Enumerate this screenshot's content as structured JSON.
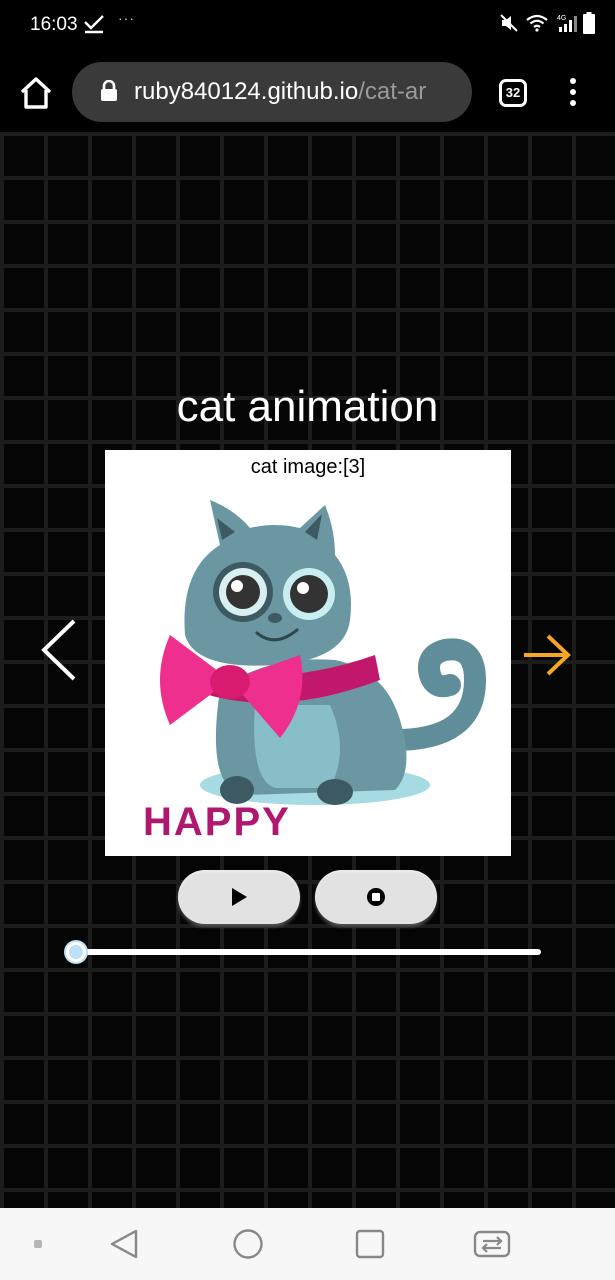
{
  "status_bar": {
    "time": "16:03",
    "notification_dots": "···",
    "network_label": "4G"
  },
  "browser": {
    "url_domain": "ruby840124.github.io",
    "url_path": "/cat-ar",
    "tab_count": "32"
  },
  "page": {
    "title": "cat animation",
    "image_caption": "cat image:[3]",
    "image_text": "HAPPY",
    "slider": {
      "value": 0,
      "min": 0,
      "max": 1
    }
  },
  "colors": {
    "next_arrow": "#f5a623",
    "background": "#000000",
    "card": "#ffffff",
    "control_button": "#e2e2e2"
  },
  "icons": {
    "home": "home-icon",
    "lock": "lock-icon",
    "menu": "more-vert-icon",
    "prev": "chevron-left-icon",
    "next": "arrow-right-icon",
    "play": "play-icon",
    "stop": "stop-icon"
  }
}
